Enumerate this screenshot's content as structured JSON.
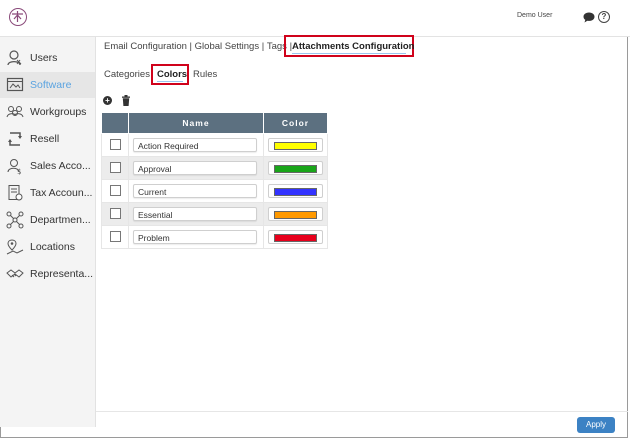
{
  "header": {
    "user_name": "Demo User"
  },
  "sidebar": {
    "items": [
      {
        "label": "Users",
        "icon": "user-icon",
        "active": false
      },
      {
        "label": "Software",
        "icon": "software-icon",
        "active": true
      },
      {
        "label": "Workgroups",
        "icon": "workgroups-icon",
        "active": false
      },
      {
        "label": "Resell",
        "icon": "resell-icon",
        "active": false
      },
      {
        "label": "Sales Acco...",
        "icon": "sales-accounts-icon",
        "active": false
      },
      {
        "label": "Tax Accoun...",
        "icon": "tax-accounts-icon",
        "active": false
      },
      {
        "label": "Departmen...",
        "icon": "departments-icon",
        "active": false
      },
      {
        "label": "Locations",
        "icon": "locations-icon",
        "active": false
      },
      {
        "label": "Representa...",
        "icon": "representatives-icon",
        "active": false
      }
    ]
  },
  "breadcrumbs": {
    "items": [
      "Email Configuration",
      "Global Settings",
      "Tags"
    ],
    "separator": "|",
    "active": "Attachments Configuration"
  },
  "subtabs": {
    "categories": "Categories",
    "colors": "Colors",
    "rules": "Rules",
    "active": "Colors"
  },
  "table": {
    "columns": {
      "name": "Name",
      "color": "Color"
    },
    "rows": [
      {
        "name": "Action Required",
        "color": "#ffff00"
      },
      {
        "name": "Approval",
        "color": "#19a519"
      },
      {
        "name": "Current",
        "color": "#3333ff"
      },
      {
        "name": "Essential",
        "color": "#ff9900"
      },
      {
        "name": "Problem",
        "color": "#e8001c"
      }
    ]
  },
  "footer": {
    "apply_label": "Apply"
  },
  "colors": {
    "accent": "#5aa3e0",
    "highlight_border": "#d0021b",
    "table_header": "#5c7080",
    "apply_button": "#3c82c4"
  }
}
